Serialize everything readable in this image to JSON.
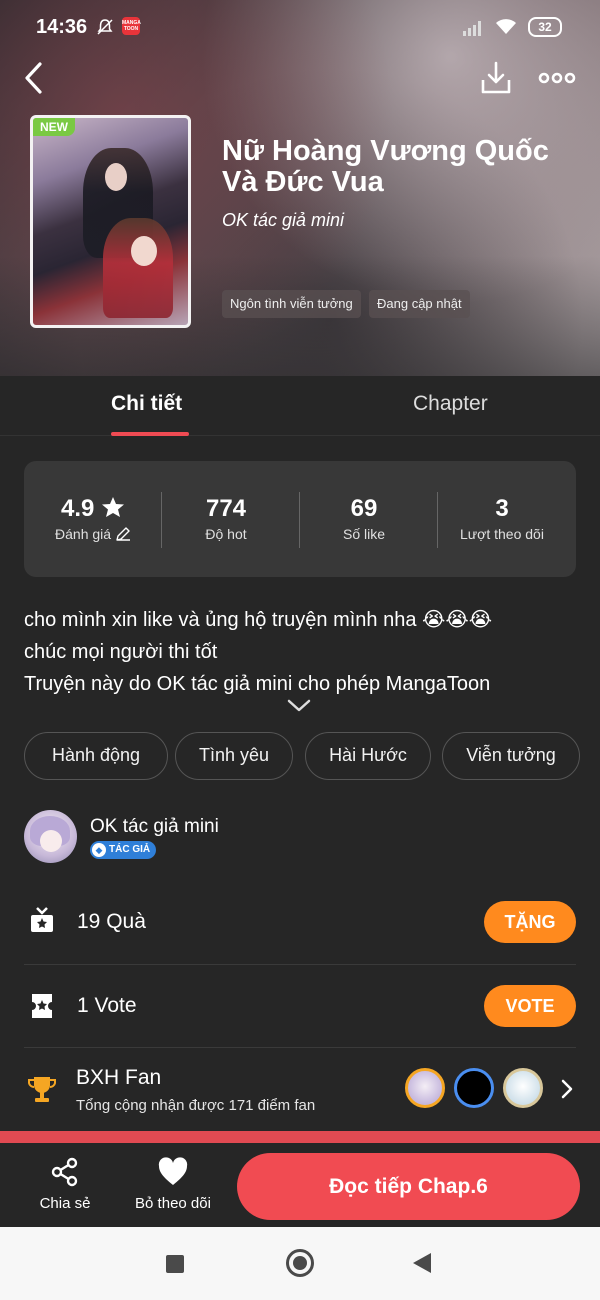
{
  "status_bar": {
    "time": "14:36",
    "app_badge": "MANGA TOON",
    "battery": "32"
  },
  "header": {
    "back_icon": "chevron-left-icon",
    "download_icon": "download-icon",
    "more_icon": "more-dots-icon"
  },
  "book": {
    "badge": "NEW",
    "title": "Nữ Hoàng Vương Quốc Và Đức Vua",
    "author": "OK tác giả mini",
    "tags": [
      "Ngôn tình viễn tưởng",
      "Đang cập nhật"
    ]
  },
  "tabs": [
    {
      "label": "Chi tiết",
      "active": true
    },
    {
      "label": "Chapter",
      "active": false
    }
  ],
  "stats": [
    {
      "value": "4.9",
      "label": "Đánh giá"
    },
    {
      "value": "774",
      "label": "Độ hot"
    },
    {
      "value": "69",
      "label": "Số like"
    },
    {
      "value": "3",
      "label": "Lượt theo dõi"
    }
  ],
  "description": {
    "line1": "cho mình xin like và ủng hộ truyện mình nha 😭😭😭",
    "line2": "chúc mọi người thi tốt",
    "line3": "Truyện này do OK tác giả mini cho phép MangaToon"
  },
  "genres": [
    "Hành động",
    "Tình yêu",
    "Hài Hước",
    "Viễn tưởng"
  ],
  "author_info": {
    "name": "OK tác giả mini",
    "badge": "TÁC GIẢ"
  },
  "gift": {
    "text": "19 Quà",
    "button": "TẶNG"
  },
  "vote": {
    "text": "1 Vote",
    "button": "VOTE"
  },
  "fan_rank": {
    "title": "BXH Fan",
    "subtitle": "Tổng cộng nhận được 171 điểm fan"
  },
  "bottom": {
    "share": "Chia sẻ",
    "unfollow": "Bỏ theo dõi",
    "read": "Đọc tiếp Chap.6"
  },
  "colors": {
    "accent": "#f14b52",
    "orange": "#ff8a1e",
    "background": "#262626",
    "card": "#383838"
  }
}
